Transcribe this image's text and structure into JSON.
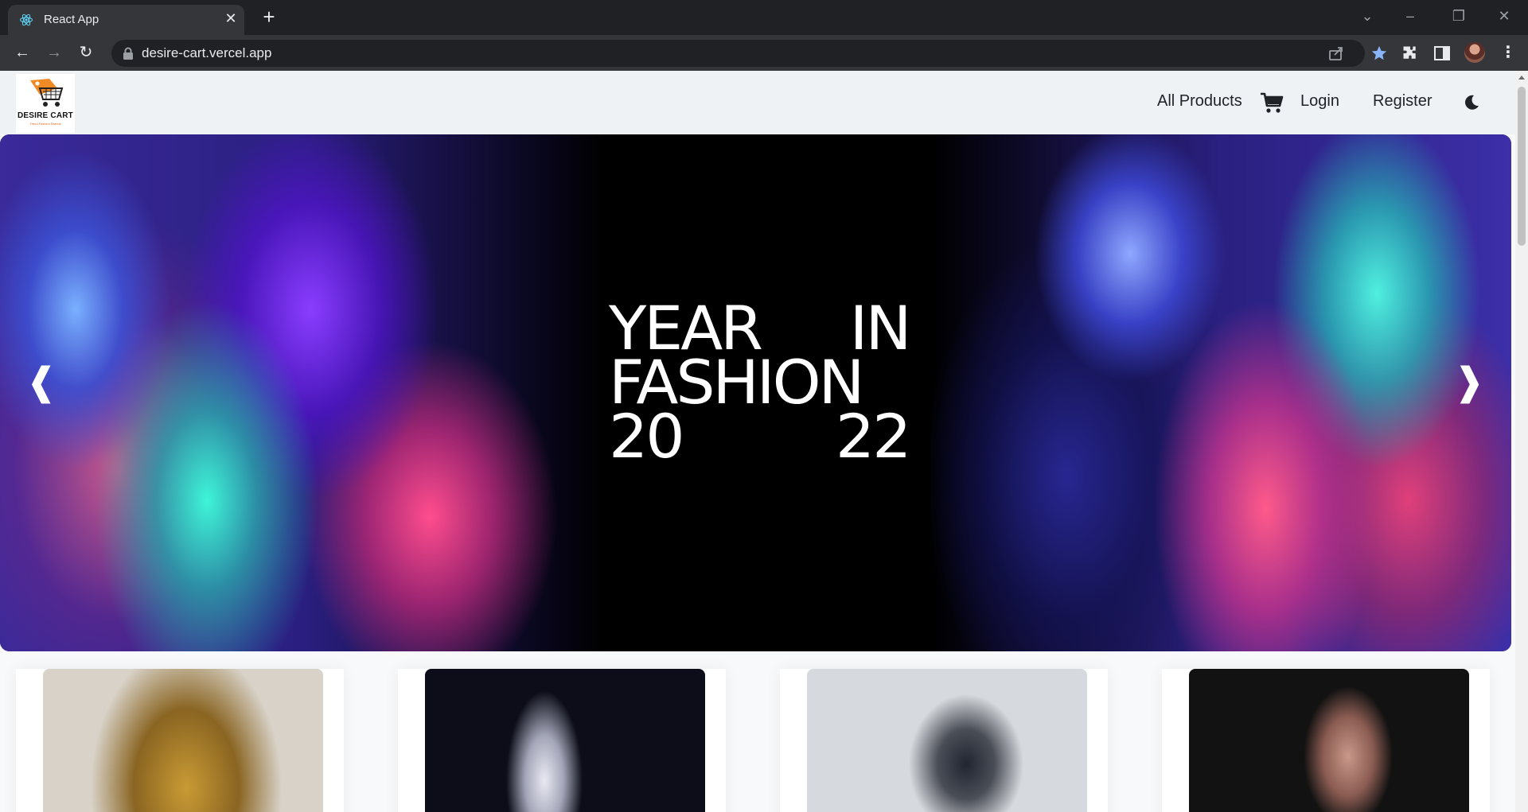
{
  "browser": {
    "tab_title": "React App",
    "url": "desire-cart.vercel.app"
  },
  "site": {
    "logo_text": "DESIRE CART",
    "logo_tagline": "Trend Fashion Brands",
    "nav": {
      "all_products": "All Products",
      "login": "Login",
      "register": "Register"
    }
  },
  "hero": {
    "line1": [
      "YEAR",
      "IN"
    ],
    "line2": [
      "FASHION"
    ],
    "line3": [
      "20",
      "22"
    ],
    "prev_arrow": "❰",
    "next_arrow": "❱"
  },
  "products": [
    {
      "image": "gold sequin outfit"
    },
    {
      "image": "runway spray dress"
    },
    {
      "image": "winter jacket in snow"
    },
    {
      "image": "model with earrings"
    }
  ],
  "colors": {
    "header_bg": "#eef2f5",
    "page_bg": "#f8f9fa",
    "chrome_bg": "#202124",
    "toolbar_bg": "#35363a",
    "accent_star": "#8ab4f8",
    "logo_orange": "#f08a24"
  }
}
